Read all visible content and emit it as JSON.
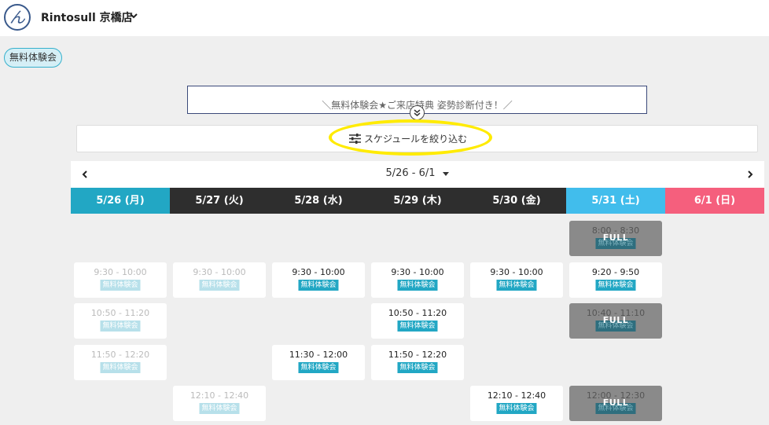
{
  "header": {
    "logo_glyph": "ん",
    "store_name": "Rintosull 京橋店"
  },
  "tag": {
    "label": "無料体験会"
  },
  "banner": {
    "text": "＼無料体験会★ご来店特典 姿勢診断付き！／"
  },
  "filter": {
    "label": "スケジュールを絞り込む"
  },
  "week": {
    "label": "5/26 - 6/1"
  },
  "colors": {
    "weekday": "#2e2e2e",
    "today": "#22a7c4",
    "saturday": "#41bdec",
    "sunday": "#f55f7d",
    "badge": "#22a7c4"
  },
  "days": [
    {
      "label": "5/26 (月)",
      "color": "#22a7c4"
    },
    {
      "label": "5/27 (火)",
      "color": "#2e2e2e"
    },
    {
      "label": "5/28 (水)",
      "color": "#2e2e2e"
    },
    {
      "label": "5/29 (木)",
      "color": "#2e2e2e"
    },
    {
      "label": "5/30 (金)",
      "color": "#2e2e2e"
    },
    {
      "label": "5/31 (土)",
      "color": "#41bdec"
    },
    {
      "label": "6/1 (日)",
      "color": "#f55f7d"
    }
  ],
  "slot_badge": "無料体験会",
  "full_label": "FULL",
  "slots": [
    {
      "day": 5,
      "row": 0,
      "time": "8:00 - 8:30",
      "state": "full"
    },
    {
      "day": 0,
      "row": 1,
      "time": "9:30 - 10:00",
      "state": "past"
    },
    {
      "day": 1,
      "row": 1,
      "time": "9:30 - 10:00",
      "state": "past"
    },
    {
      "day": 2,
      "row": 1,
      "time": "9:30 - 10:00",
      "state": "open"
    },
    {
      "day": 3,
      "row": 1,
      "time": "9:30 - 10:00",
      "state": "open"
    },
    {
      "day": 4,
      "row": 1,
      "time": "9:30 - 10:00",
      "state": "open"
    },
    {
      "day": 5,
      "row": 1,
      "time": "9:20 - 9:50",
      "state": "open"
    },
    {
      "day": 0,
      "row": 2,
      "time": "10:50 - 11:20",
      "state": "past"
    },
    {
      "day": 3,
      "row": 2,
      "time": "10:50 - 11:20",
      "state": "open"
    },
    {
      "day": 5,
      "row": 2,
      "time": "10:40 - 11:10",
      "state": "full"
    },
    {
      "day": 0,
      "row": 3,
      "time": "11:50 - 12:20",
      "state": "past"
    },
    {
      "day": 2,
      "row": 3,
      "time": "11:30 - 12:00",
      "state": "open"
    },
    {
      "day": 3,
      "row": 3,
      "time": "11:50 - 12:20",
      "state": "open"
    },
    {
      "day": 1,
      "row": 4,
      "time": "12:10 - 12:40",
      "state": "past"
    },
    {
      "day": 4,
      "row": 4,
      "time": "12:10 - 12:40",
      "state": "open"
    },
    {
      "day": 5,
      "row": 4,
      "time": "12:00 - 12:30",
      "state": "full"
    }
  ]
}
